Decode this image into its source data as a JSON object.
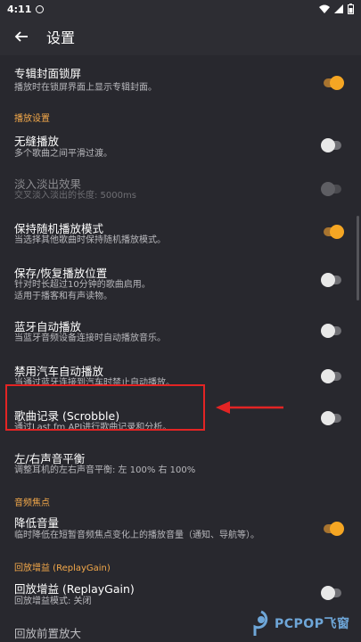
{
  "status": {
    "time": "4:11"
  },
  "appbar": {
    "title": "设置"
  },
  "rows": {
    "album_lock": {
      "title": "专辑封面锁屏",
      "summary": "播放时在锁屏界面上显示专辑封面。",
      "on": true
    },
    "section_playback": "播放设置",
    "gapless": {
      "title": "无缝播放",
      "summary": "多个歌曲之间平滑过渡。",
      "on": false
    },
    "crossfade": {
      "title": "淡入淡出效果",
      "summary": "交叉淡入淡出的长度: 5000ms",
      "on": false,
      "disabled": true
    },
    "shuffle": {
      "title": "保持随机播放模式",
      "summary": "当选择其他歌曲时保持随机播放模式。",
      "on": true
    },
    "resume": {
      "title": "保存/恢复播放位置",
      "summary1": "针对时长超过10分钟的歌曲启用。",
      "summary2": "适用于播客和有声读物。",
      "on": false
    },
    "bt_autoplay": {
      "title": "蓝牙自动播放",
      "summary": "当蓝牙音频设备连接时自动播放音乐。",
      "on": false
    },
    "car_autoplay": {
      "title": "禁用汽车自动播放",
      "summary": "当通过蓝牙连接到汽车时禁止自动播放。",
      "on": false
    },
    "scrobble": {
      "title": "歌曲记录 (Scrobble)",
      "summary": "通过Last.fm API进行歌曲记录和分析。",
      "on": false
    },
    "balance": {
      "title": "左/右声音平衡",
      "summary": "调整耳机的左右声音平衡: 左 100% 右 100%"
    },
    "section_focus": "音频焦点",
    "duck": {
      "title": "降低音量",
      "summary": "临时降低在短暂音频焦点变化上的播放音量（通知、导航等）。",
      "on": true
    },
    "section_replaygain": "回放增益 (ReplayGain)",
    "replaygain": {
      "title": "回放增益 (ReplayGain)",
      "summary": "回放增益模式: 关闭",
      "on": false
    },
    "preamp": {
      "title": "回放前置放大"
    }
  },
  "watermark": {
    "text": "PCPOP飞窗"
  },
  "colors": {
    "accent": "#f5a623",
    "background": "#28282e",
    "highlight": "#e32424"
  }
}
